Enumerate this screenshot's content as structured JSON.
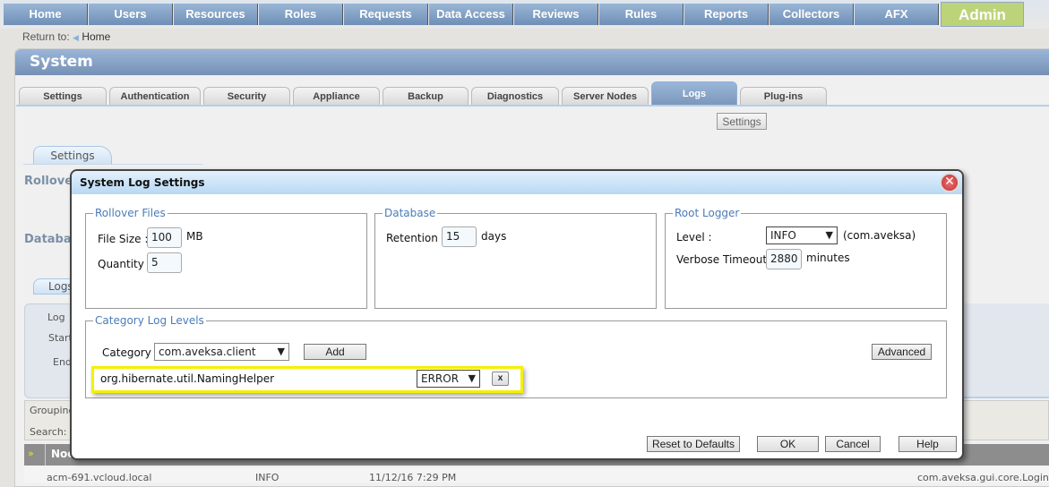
{
  "nav": {
    "items": [
      "Home",
      "Users",
      "Resources",
      "Roles",
      "Requests",
      "Data Access",
      "Reviews",
      "Rules",
      "Reports",
      "Collectors",
      "AFX"
    ],
    "active": "Admin",
    "active_color": "#bdd37a"
  },
  "breadcrumb": {
    "prefix": "Return to:",
    "link": "Home"
  },
  "page_title": "System",
  "tabs": [
    "Settings",
    "Authentication",
    "Security",
    "Appliance",
    "Backup",
    "Diagnostics",
    "Server Nodes",
    "Logs",
    "Plug-ins"
  ],
  "active_tab": "Logs",
  "settings_button": "Settings",
  "background": {
    "subtab": "Settings",
    "rollover": "Rollove",
    "database": "Databa",
    "logs_tab": "Logs",
    "log": "Log",
    "start": "Start",
    "end": "End",
    "grouping": "Grouping",
    "search": "Search:",
    "col_node": "Noc",
    "row": {
      "node": "acm-691.vcloud.local",
      "level": "INFO",
      "time": "11/12/16 7:29 PM",
      "source": "com.aveksa.gui.core.LoginI"
    }
  },
  "dialog": {
    "title": "System Log Settings",
    "rollover": {
      "legend": "Rollover Files",
      "file_size_label": "File Size :",
      "file_size": "100",
      "file_size_unit": "MB",
      "quantity_label": "Quantity :",
      "quantity": "5"
    },
    "database": {
      "legend": "Database",
      "retention_label": "Retention :",
      "retention": "15",
      "retention_unit": "days"
    },
    "root_logger": {
      "legend": "Root Logger",
      "level_label": "Level :",
      "level": "INFO",
      "level_note": "(com.aveksa)",
      "verbose_label": "Verbose Timeout :",
      "verbose": "2880",
      "verbose_unit": "minutes"
    },
    "category": {
      "legend": "Category Log Levels",
      "label": "Category :",
      "value": "com.aveksa.client",
      "add": "Add",
      "advanced": "Advanced",
      "entry": {
        "name": "org.hibernate.util.NamingHelper",
        "level": "ERROR",
        "remove": "x"
      }
    },
    "buttons": {
      "reset": "Reset to Defaults",
      "ok": "OK",
      "cancel": "Cancel",
      "help": "Help"
    }
  }
}
